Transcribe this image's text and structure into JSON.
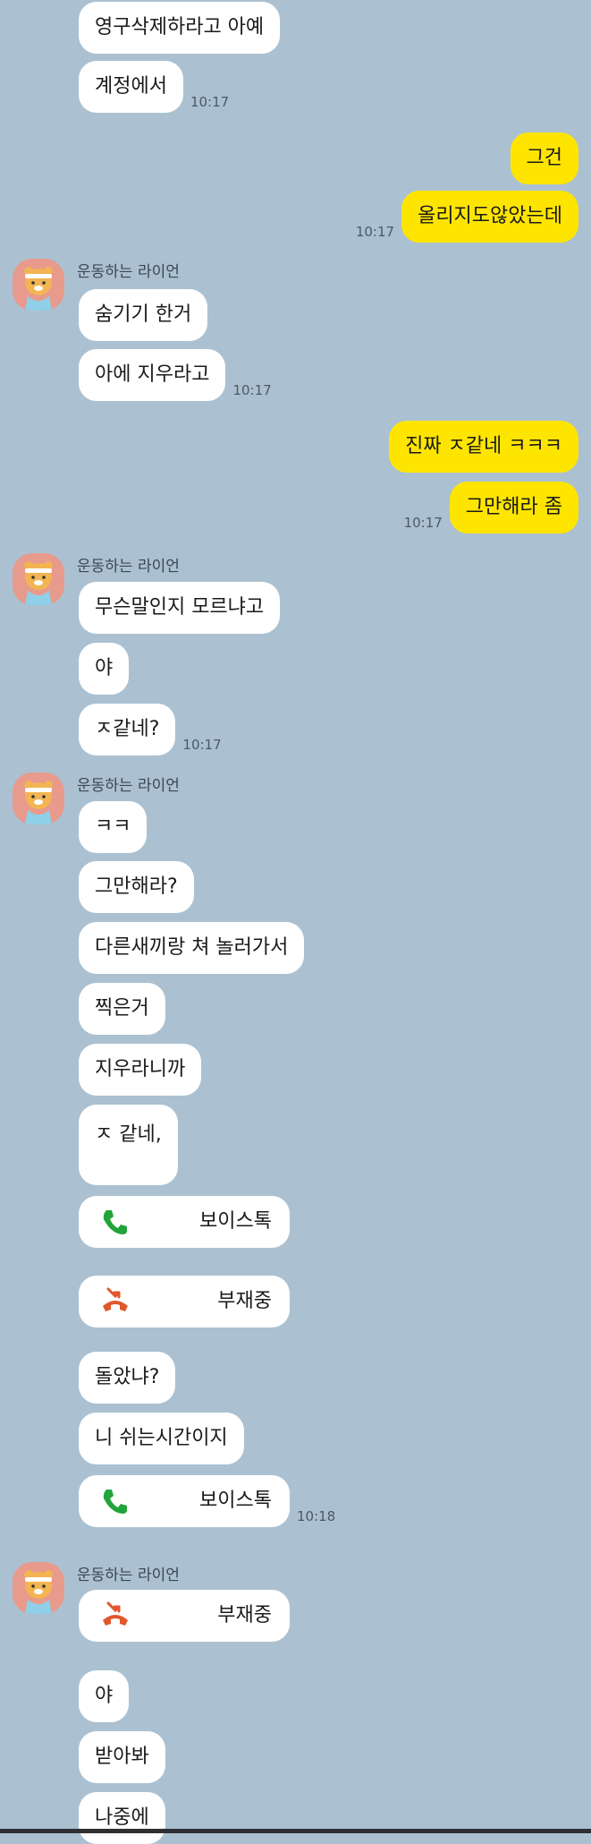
{
  "chat": {
    "sender_name": "운동하는 라이언",
    "colors": {
      "background": "#abc1d1",
      "sent_bubble": "#fee500",
      "received_bubble": "#ffffff",
      "call_green": "#21a53a",
      "call_red": "#e1572c"
    },
    "messages": [
      {
        "text": "영구삭제하라고 아예"
      },
      {
        "text": "계정에서",
        "time": "10:17"
      },
      {
        "text": "그건"
      },
      {
        "text": "올리지도않았는데",
        "time": "10:17"
      },
      {
        "text": "숨기기 한거"
      },
      {
        "text": "아에 지우라고",
        "time": "10:17"
      },
      {
        "text": "진짜 ㅈ같네 ㅋㅋㅋ"
      },
      {
        "text": "그만해라 좀",
        "time": "10:17"
      },
      {
        "text": "무슨말인지 모르냐고"
      },
      {
        "text": "야"
      },
      {
        "text": "ㅈ같네?",
        "time": "10:17"
      },
      {
        "text": "ㅋㅋ"
      },
      {
        "text": "그만해라?"
      },
      {
        "text": "다른새끼랑 쳐 놀러가서"
      },
      {
        "text": "찍은거"
      },
      {
        "text": "지우라니까"
      },
      {
        "text": "ㅈ 같네,"
      },
      {
        "text": "보이스톡",
        "icon": "phone-call-icon"
      },
      {
        "text": "부재중",
        "icon": "missed-call-icon"
      },
      {
        "text": "돌았냐?"
      },
      {
        "text": "니 쉬는시간이지"
      },
      {
        "text": "보이스톡",
        "icon": "phone-call-icon",
        "time": "10:18"
      },
      {
        "text": "부재중",
        "icon": "missed-call-icon"
      },
      {
        "text": "야"
      },
      {
        "text": "받아봐"
      },
      {
        "text": "나중에"
      }
    ]
  }
}
